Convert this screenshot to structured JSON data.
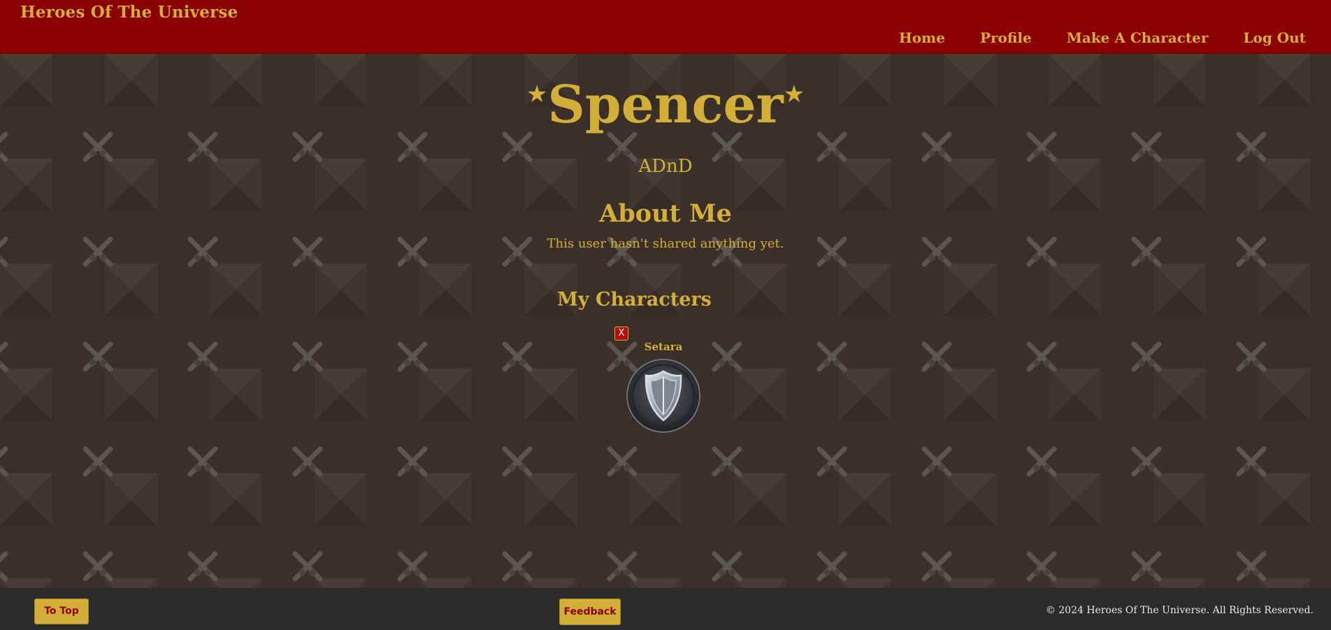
{
  "header": {
    "brand": "Heroes Of The Universe",
    "nav": [
      {
        "label": "Home"
      },
      {
        "label": "Profile"
      },
      {
        "label": "Make A Character"
      },
      {
        "label": "Log Out"
      }
    ]
  },
  "profile": {
    "star": "★",
    "username": "Spencer",
    "game_system": "ADnD",
    "about_heading": "About Me",
    "about_text": "This user hasn't shared anything yet.",
    "characters_heading": "My Characters",
    "characters": [
      {
        "name": "Setara",
        "delete_label": "X",
        "avatar_icon": "shield-icon"
      }
    ]
  },
  "footer": {
    "to_top_label": "To Top",
    "feedback_label": "Feedback",
    "copyright": "© 2024 Heroes Of The Universe. All Rights Reserved."
  },
  "colors": {
    "header_bg": "#8b0000",
    "accent_gold": "#d4af37",
    "footer_bg": "#2b2b2b",
    "page_bg": "#3b3029"
  }
}
